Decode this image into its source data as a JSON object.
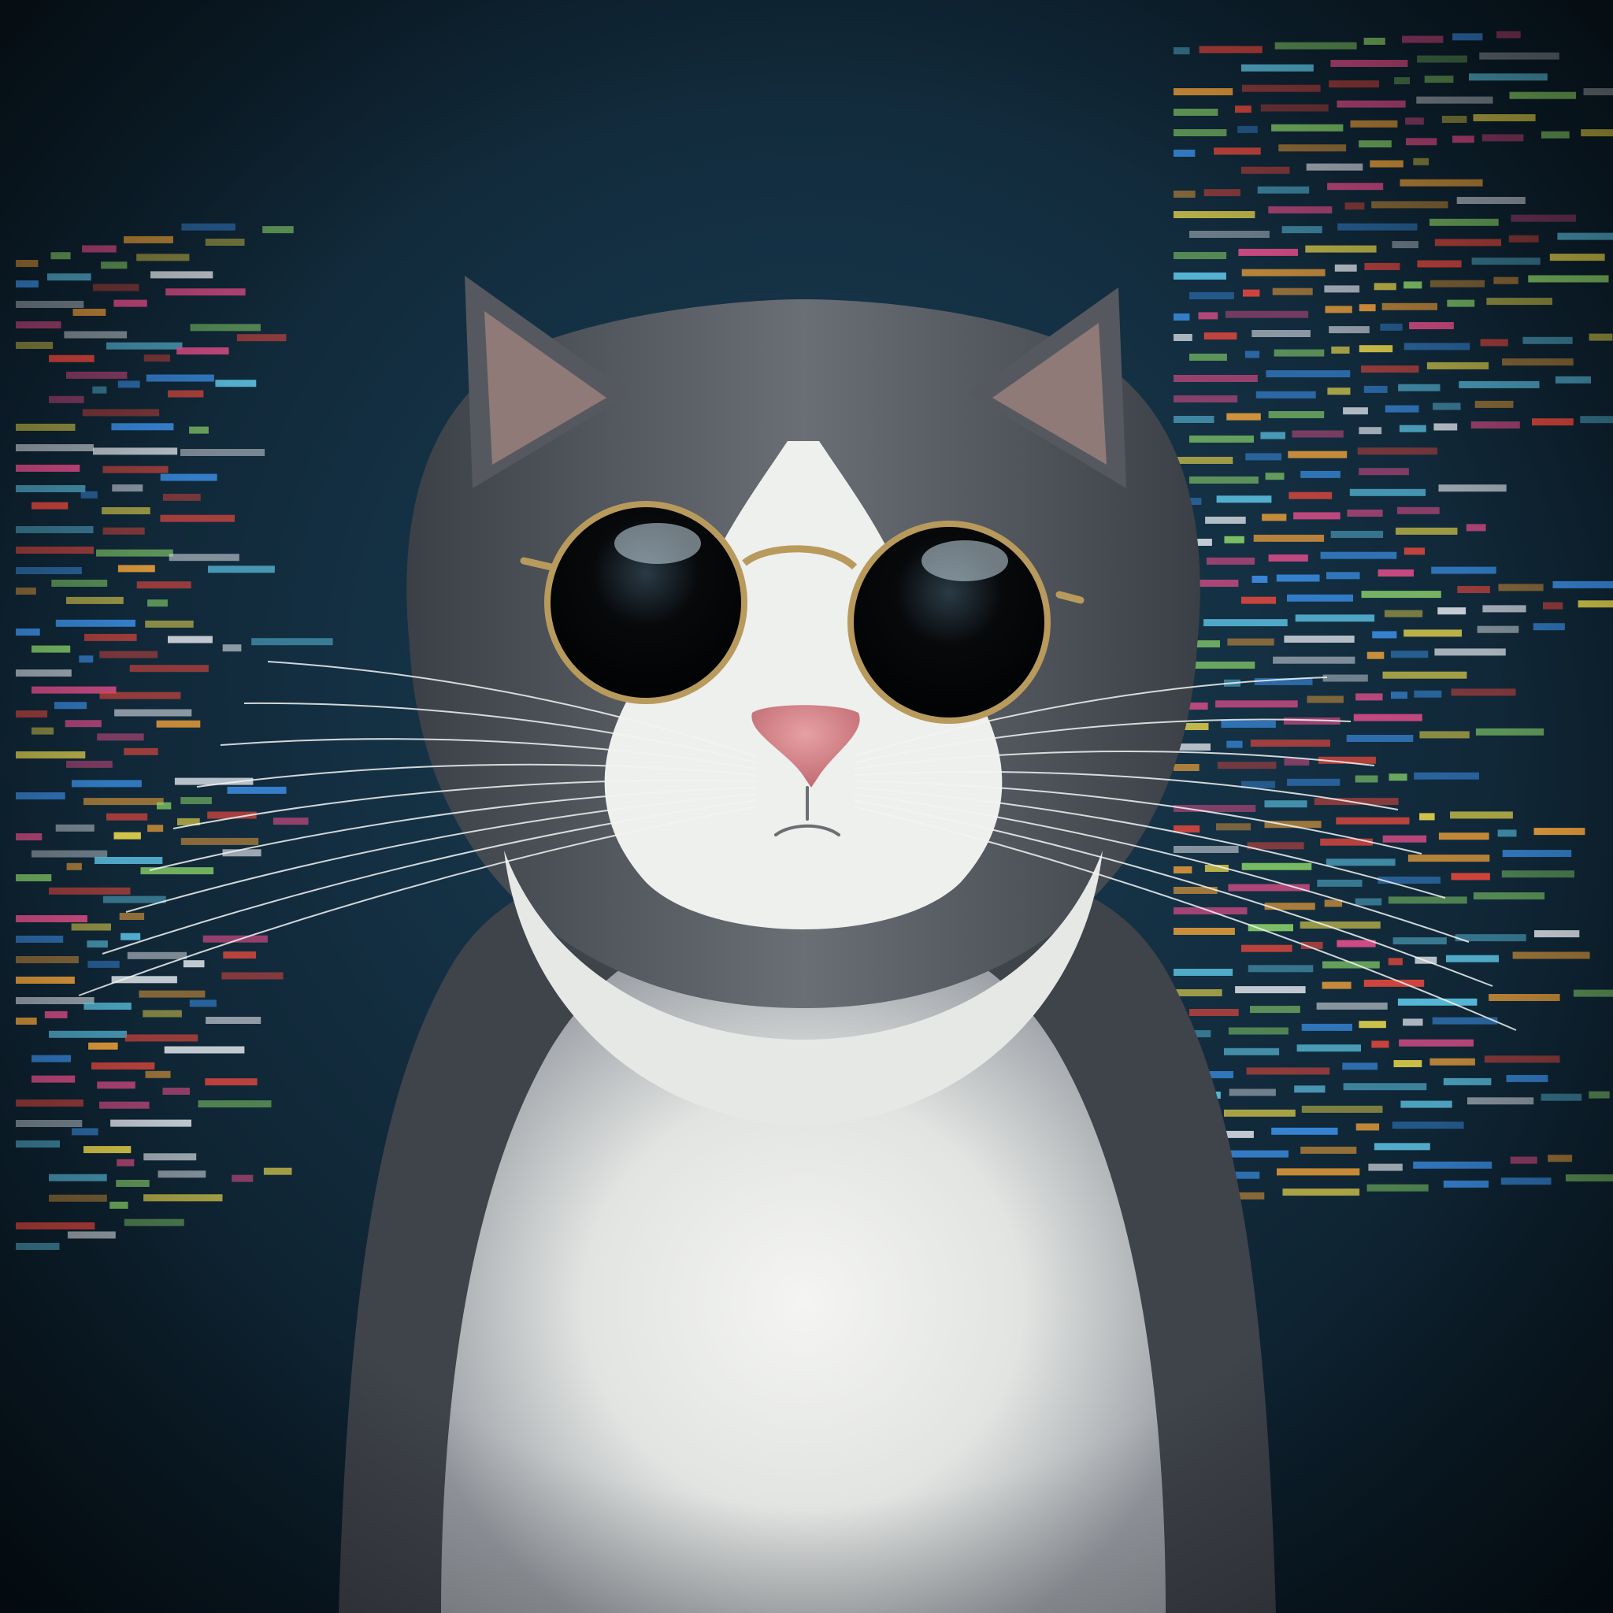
{
  "colors": {
    "background_center": "#1b3f57",
    "background_edge": "#081620",
    "code_palette": [
      "#e5483d",
      "#f2a33a",
      "#e8d64c",
      "#3c8fe6",
      "#5fc7e8",
      "#d8dde3",
      "#e84f8c",
      "#8ad36a"
    ],
    "fur_dark": "#4a4e55",
    "fur_mid": "#8d9299",
    "fur_white": "#eef0ee",
    "ear_inner": "#8f7a78",
    "nose": "#d98a8e",
    "lens": "#050709",
    "lens_highlight": "#c9dbe6",
    "frame": "#b89a5c"
  },
  "icons": {
    "subject": "cat-with-sunglasses",
    "left_panel": "code-screen-left",
    "right_panel": "code-screen-right"
  }
}
